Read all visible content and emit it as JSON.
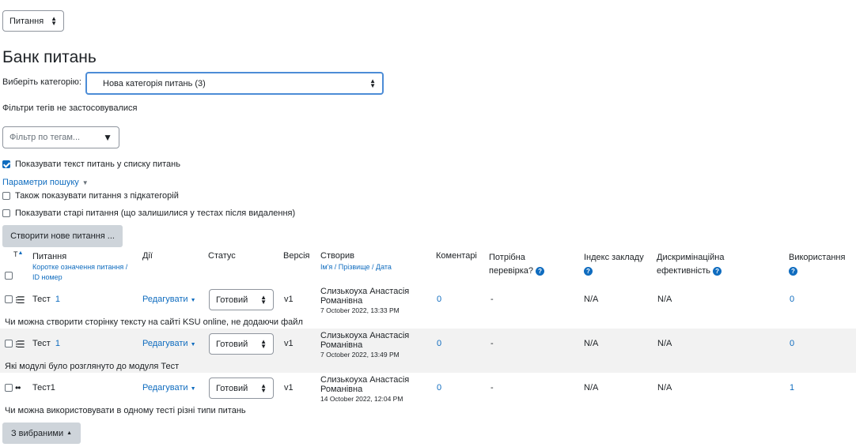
{
  "top_select": {
    "value": "Питання"
  },
  "page_title": "Банк питань",
  "category": {
    "label": "Виберіть категорію:",
    "value": "Нова категорія питань (3)"
  },
  "tag_filter_note": "Фільтри тегів не застосовувалися",
  "tag_filter": {
    "placeholder": "Фільтр по тегам..."
  },
  "show_text_label": "Показувати текст питань у списку питань",
  "search_params": {
    "label": "Параметри пошуку"
  },
  "also_subcats_label": "Також показувати питання з підкатегорій",
  "show_old_label": "Показувати старі питання (що залишилися у тестах після видалення)",
  "create_button": "Створити нове питання ...",
  "table": {
    "headers": {
      "type_sort": "T",
      "question": "Питання",
      "question_sub": "Коротке означення питання / ID номер",
      "actions": "Дії",
      "status": "Статус",
      "version": "Версія",
      "created_by": "Створив",
      "created_by_sub": "Ім'я / Прізвище / Дата",
      "comments": "Коментарі",
      "needs_review": "Потрібна перевірка?",
      "facility_index": "Індекс закладу",
      "discrimination": "Дискримінаційна ефективність",
      "usage": "Використання"
    },
    "rows": [
      {
        "name": "Тест",
        "id": "1",
        "action": "Редагувати",
        "status": "Готовий",
        "version": "v1",
        "creator": "Слизькоуха Анастасія Романівна",
        "date": "7 October 2022, 13:33 PM",
        "comments": "0",
        "needs_review": "-",
        "facility": "N/A",
        "discrimination": "N/A",
        "usage": "0",
        "text": "Чи можна створити сторінку тексту на сайті KSU online, не додаючи файл"
      },
      {
        "name": "Тест",
        "id": "1",
        "action": "Редагувати",
        "status": "Готовий",
        "version": "v1",
        "creator": "Слизькоуха Анастасія Романівна",
        "date": "7 October 2022, 13:49 PM",
        "comments": "0",
        "needs_review": "-",
        "facility": "N/A",
        "discrimination": "N/A",
        "usage": "0",
        "text": "Які модулі було розглянуто до модуля Тест"
      },
      {
        "name": "Тест1",
        "id": "",
        "action": "Редагувати",
        "status": "Готовий",
        "version": "v1",
        "creator": "Слизькоуха Анастасія Романівна",
        "date": "14 October 2022, 12:04 PM",
        "comments": "0",
        "needs_review": "-",
        "facility": "N/A",
        "discrimination": "N/A",
        "usage": "1",
        "text": "Чи можна використовувати в одному тесті різні типи питань"
      }
    ]
  },
  "bulk_button": "З вибраними",
  "colors": {
    "accent": "#0f6cbf",
    "focus": "#4c8cd6",
    "button_grey": "#ced4da",
    "row_stripe": "#f2f2f2"
  }
}
